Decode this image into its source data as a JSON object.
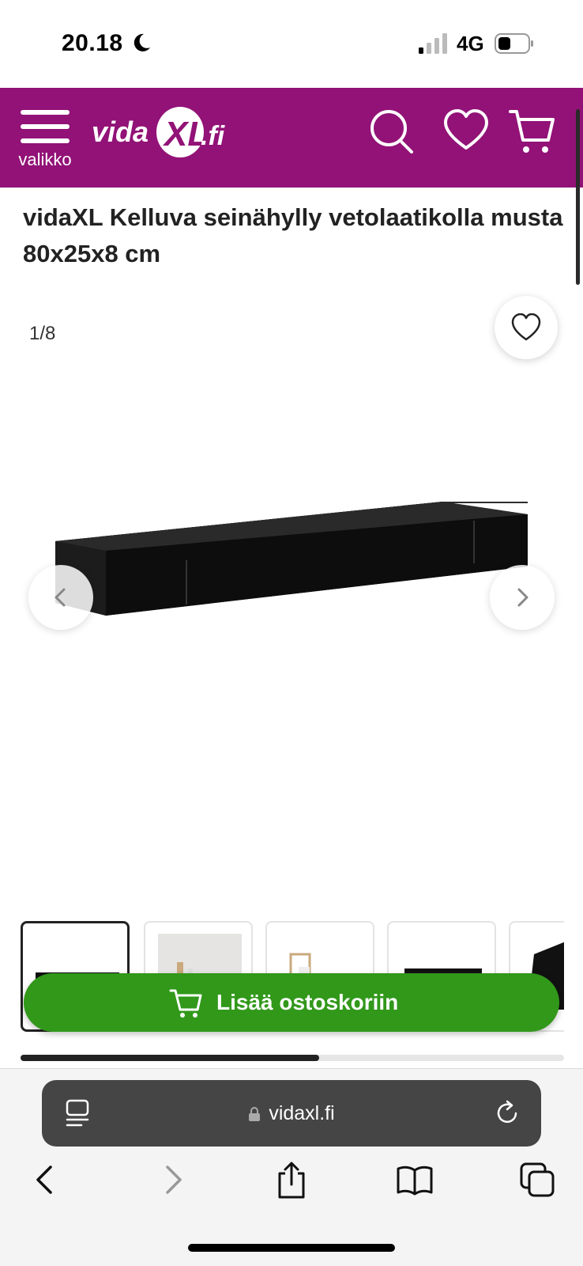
{
  "status_bar": {
    "time": "20.18",
    "network": "4G"
  },
  "header": {
    "menu_label": "valikko",
    "logo_text": "vidaXL.fi",
    "brand_color": "#921277",
    "icons": [
      "search-icon",
      "heart-icon",
      "cart-icon"
    ]
  },
  "product": {
    "title": "vidaXL Kelluva seinähylly vetolaatikolla musta 80x25x8 cm",
    "image_counter": "1/8",
    "thumbnail_count_visible": 5
  },
  "actions": {
    "add_to_cart_label": "Lisää ostoskoriin",
    "add_to_cart_color": "#31981a"
  },
  "gallery": {
    "scroll_progress": 0.55
  },
  "browser": {
    "url": "vidaxl.fi",
    "toolbar_icons": [
      "back-icon",
      "forward-icon",
      "share-icon",
      "bookmarks-icon",
      "tabs-icon"
    ]
  }
}
